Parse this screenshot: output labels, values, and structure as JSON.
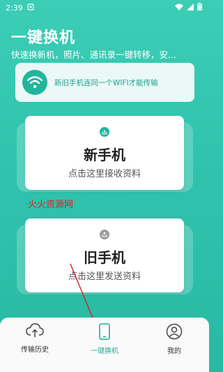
{
  "status_bar": {
    "time": "2:39"
  },
  "header": {
    "title": "一键换机",
    "subtitle": "快速换新机，照片、通讯录一键转移，安..."
  },
  "wifi_notice": {
    "text": "新旧手机连同一个WIFI才能传输"
  },
  "cards": [
    {
      "title": "新手机",
      "subtitle": "点击这里接收资料"
    },
    {
      "title": "旧手机",
      "subtitle": "点击这里发送资料"
    }
  ],
  "watermark": "火火资源网",
  "tabbar": {
    "items": [
      {
        "label": "传输历史",
        "icon": "upload-cloud-icon"
      },
      {
        "label": "一键换机",
        "icon": "phone-icon",
        "active": true
      },
      {
        "label": "我的",
        "icon": "user-icon"
      }
    ]
  },
  "colors": {
    "accent": "#22b59d",
    "background": "#33c7b0",
    "arrow": "#d32222",
    "watermark": "#e02020"
  }
}
